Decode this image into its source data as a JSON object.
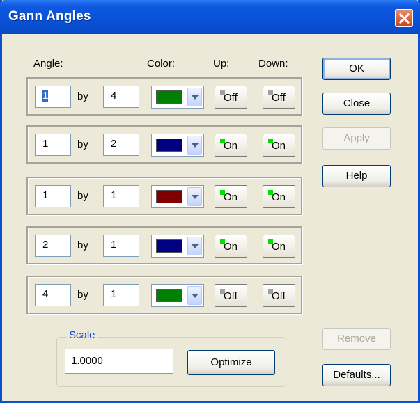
{
  "window": {
    "title": "Gann Angles"
  },
  "headers": {
    "angle": "Angle:",
    "color": "Color:",
    "up": "Up:",
    "down": "Down:"
  },
  "by_label": "by",
  "rows": [
    {
      "num": "1",
      "den": "4",
      "color": "#008000",
      "up": "Off",
      "down": "Off"
    },
    {
      "num": "1",
      "den": "2",
      "color": "#000080",
      "up": "On",
      "down": "On"
    },
    {
      "num": "1",
      "den": "1",
      "color": "#800000",
      "up": "On",
      "down": "On"
    },
    {
      "num": "2",
      "den": "1",
      "color": "#000080",
      "up": "On",
      "down": "On"
    },
    {
      "num": "4",
      "den": "1",
      "color": "#008000",
      "up": "Off",
      "down": "Off"
    }
  ],
  "toggle_colors": {
    "on": "#00E000",
    "off": "#A0A0A0"
  },
  "buttons": {
    "ok": "OK",
    "close": "Close",
    "apply": "Apply",
    "help": "Help",
    "remove": "Remove",
    "defaults": "Defaults..."
  },
  "scale": {
    "legend": "Scale",
    "value": "1.0000",
    "optimize": "Optimize"
  }
}
